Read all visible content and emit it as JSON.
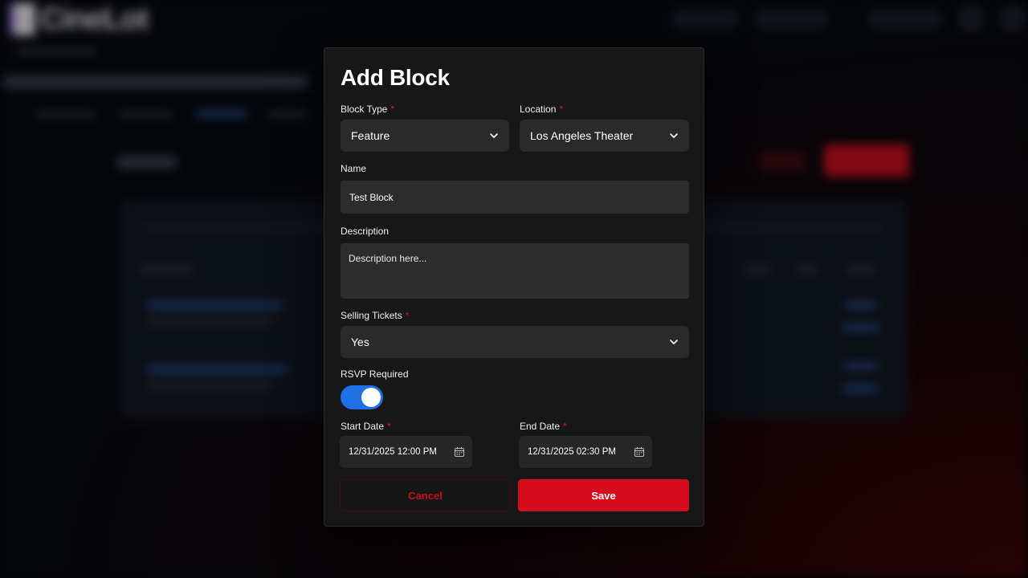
{
  "background": {
    "app_name": "CineLot"
  },
  "modal": {
    "title": "Add Block",
    "block_type": {
      "label": "Block Type",
      "required": "*",
      "value": "Feature"
    },
    "location": {
      "label": "Location",
      "required": "*",
      "value": "Los Angeles Theater"
    },
    "name": {
      "label": "Name",
      "value": "Test Block"
    },
    "description": {
      "label": "Description",
      "placeholder": "Description here..."
    },
    "selling_tickets": {
      "label": "Selling Tickets",
      "required": "*",
      "value": "Yes"
    },
    "rsvp_required": {
      "label": "RSVP Required",
      "enabled": true
    },
    "start_date": {
      "label": "Start Date",
      "required": "*",
      "value": "12/31/2025 12:00 PM"
    },
    "end_date": {
      "label": "End Date",
      "required": "*",
      "value": "12/31/2025 02:30 PM"
    },
    "cancel_label": "Cancel",
    "save_label": "Save"
  },
  "icons": {
    "select_arrow": "chevron-down-icon",
    "date_picker": "calendar-icon"
  },
  "colors": {
    "accent_red": "#d60c1c",
    "toggle_blue": "#1f6fe5",
    "modal_bg": "#171717"
  }
}
